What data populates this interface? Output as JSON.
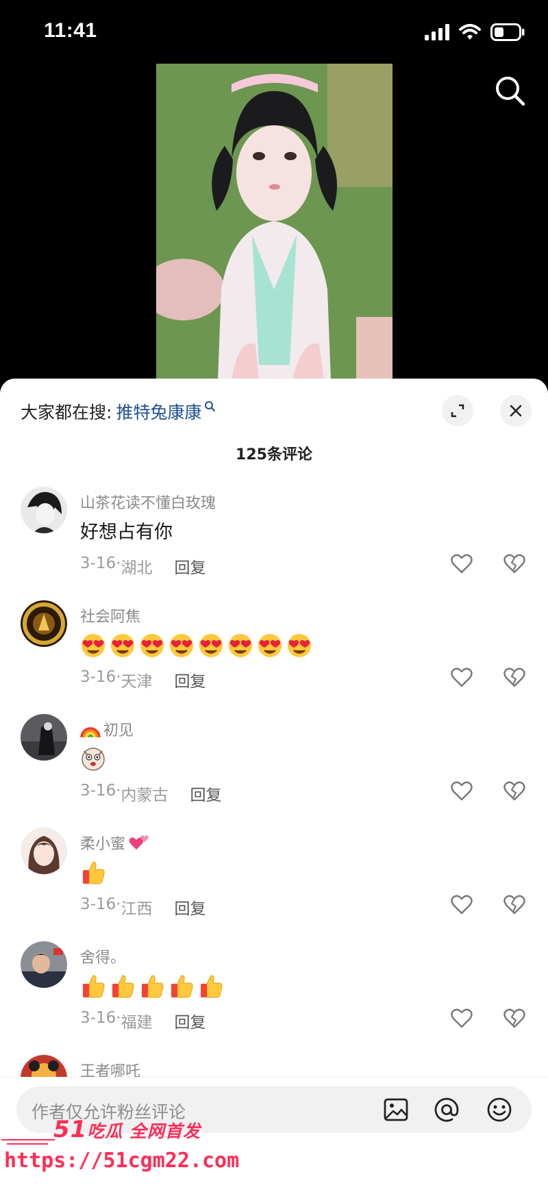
{
  "status_bar": {
    "time": "11:41"
  },
  "hot_search": {
    "prefix": "大家都在搜:",
    "keyword": "推特兔康康"
  },
  "comment_count": "125条评论",
  "comments": [
    {
      "user": "山茶花读不懂白玫瑰",
      "text": "好想占有你",
      "date": "3-16",
      "location": "湖北",
      "reply": "回复"
    },
    {
      "user": "社会阿焦",
      "text": "",
      "emojis": [
        "heart-eyes-emoji",
        "heart-eyes-emoji",
        "heart-eyes-emoji",
        "heart-eyes-emoji",
        "heart-eyes-emoji",
        "heart-eyes-emoji",
        "heart-eyes-emoji",
        "heart-eyes-emoji"
      ],
      "date": "3-16",
      "location": "天津",
      "reply": "回复"
    },
    {
      "user": "初见",
      "user_prefix_emoji": "rainbow-emoji",
      "text": "",
      "emojis": [
        "funny-face-emoji"
      ],
      "date": "3-16",
      "location": "内蒙古",
      "reply": "回复"
    },
    {
      "user": "柔小蜜",
      "user_suffix_emoji": "two-hearts-emoji",
      "text": "",
      "emojis": [
        "thumbs-up-emoji"
      ],
      "date": "3-16",
      "location": "江西",
      "reply": "回复"
    },
    {
      "user": "舍得。",
      "text": "",
      "emojis": [
        "thumbs-up-emoji",
        "thumbs-up-emoji",
        "thumbs-up-emoji",
        "thumbs-up-emoji",
        "thumbs-up-emoji"
      ],
      "date": "3-16",
      "location": "福建",
      "reply": "回复"
    },
    {
      "user": "王者哪吒"
    }
  ],
  "input": {
    "placeholder": "作者仅允许粉丝评论"
  },
  "watermark": {
    "brand_num": "51",
    "brand": "吃瓜 全网首发",
    "url": "https://51cgm22.com"
  },
  "colors": {
    "keyword_link": "#1d4f8f",
    "watermark": "#ff2d55",
    "sheet_bg": "#ffffff"
  }
}
